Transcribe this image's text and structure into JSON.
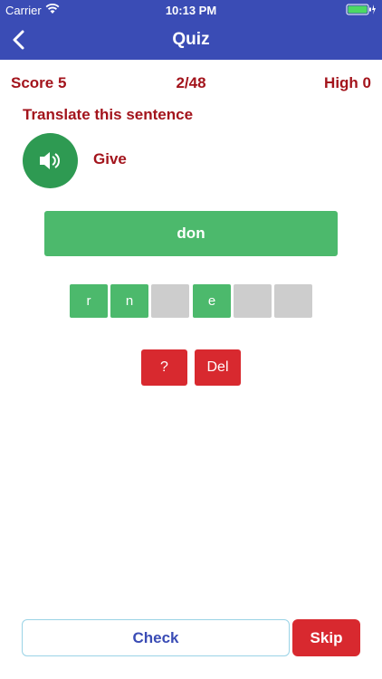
{
  "status_bar": {
    "carrier": "Carrier",
    "time": "10:13 PM",
    "icons": [
      "wifi-icon",
      "battery-icon"
    ]
  },
  "nav": {
    "title": "Quiz",
    "back_icon": "chevron-left-icon"
  },
  "stats": {
    "score": "Score  5",
    "progress": "2/48",
    "high": "High  0"
  },
  "question": {
    "prompt": "Translate this sentence",
    "speaker_icon": "speaker-icon",
    "word": "Give",
    "answer": "don"
  },
  "letter_tiles": [
    {
      "letter": "r",
      "state": "filled"
    },
    {
      "letter": "n",
      "state": "filled"
    },
    {
      "letter": "",
      "state": "empty"
    },
    {
      "letter": "e",
      "state": "filled"
    },
    {
      "letter": "",
      "state": "empty"
    },
    {
      "letter": "",
      "state": "empty"
    }
  ],
  "actions": {
    "hint": "?",
    "delete": "Del"
  },
  "footer": {
    "check": "Check",
    "skip": "Skip"
  },
  "colors": {
    "primary": "#3a4cb5",
    "accent_red": "#a3141c",
    "button_red": "#d8292f",
    "green": "#4cb96c",
    "dark_green": "#2e9a52",
    "empty_tile": "#cdcdcd"
  }
}
